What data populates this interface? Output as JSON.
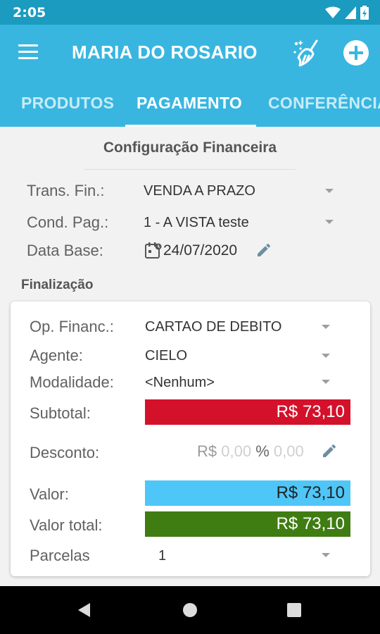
{
  "status": {
    "time": "2:05"
  },
  "app": {
    "title": "MARIA DO ROSARIO"
  },
  "tabs": [
    {
      "label": "PRODUTOS"
    },
    {
      "label": "PAGAMENTO"
    },
    {
      "label": "CONFERÊNCIA"
    }
  ],
  "config": {
    "title": "Configuração Financeira",
    "trans_fin": {
      "label": "Trans. Fin.:",
      "value": "VENDA A PRAZO"
    },
    "cond_pag": {
      "label": "Cond. Pag.:",
      "value": "1 - A VISTA teste"
    },
    "data_base": {
      "label": "Data Base:",
      "value": "24/07/2020"
    }
  },
  "finalizacao": {
    "title": "Finalização",
    "op_financ": {
      "label": "Op. Financ.:",
      "value": "CARTAO DE DEBITO"
    },
    "agente": {
      "label": "Agente:",
      "value": "CIELO"
    },
    "modalidade": {
      "label": "Modalidade:",
      "value": "<Nenhum>"
    },
    "subtotal": {
      "label": "Subtotal:",
      "value": "R$  73,10"
    },
    "desconto": {
      "label": "Desconto:",
      "currency": "R$",
      "amount": "0,00",
      "percent_sign": "%",
      "percent": "0,00"
    },
    "valor": {
      "label": "Valor:",
      "value": "R$  73,10"
    },
    "valor_total": {
      "label": "Valor total:",
      "value": "R$  73,10"
    },
    "parcelas": {
      "label": "Parcelas",
      "value": "1"
    }
  },
  "colors": {
    "statusbar": "#1a9bbf",
    "appbar": "#39b6e0",
    "subtotal": "#d4112b",
    "valor": "#4fc6f8",
    "valor_total": "#3f7c12"
  },
  "icons": [
    "menu-icon",
    "broom-icon",
    "add-circle-icon",
    "wifi-icon",
    "signal-icon",
    "battery-icon",
    "calendar-icon",
    "pencil-icon",
    "chevron-down-icon",
    "back-icon",
    "home-icon",
    "recents-icon"
  ]
}
